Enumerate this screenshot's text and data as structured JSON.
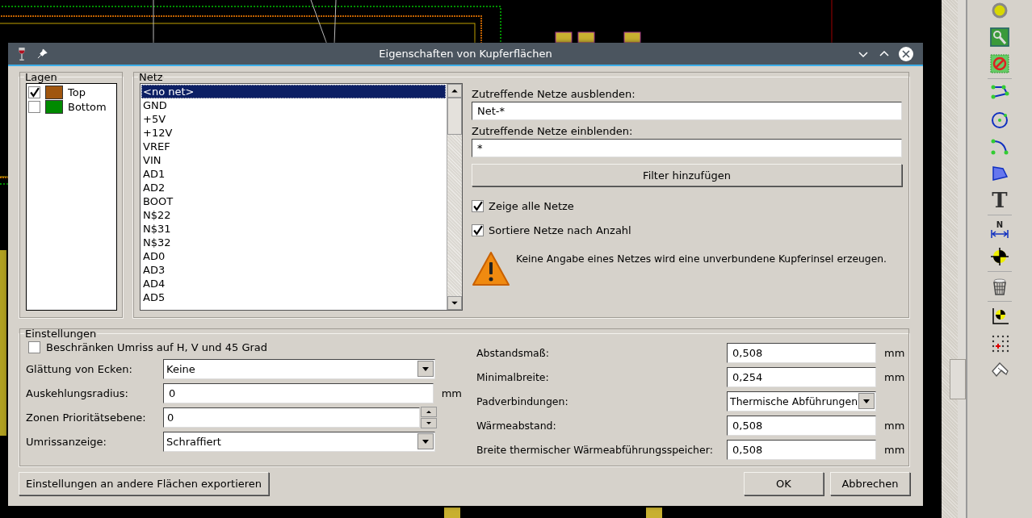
{
  "window": {
    "title": "Eigenschaften von Kupferflächen"
  },
  "layers": {
    "title": "Lagen",
    "items": [
      {
        "label": "Top",
        "checked": true,
        "color": "#a0560f"
      },
      {
        "label": "Bottom",
        "checked": false,
        "color": "#008a00"
      }
    ]
  },
  "net": {
    "title": "Netz",
    "items": [
      {
        "label": "<no net>",
        "selected": true
      },
      {
        "label": "GND",
        "selected": false
      },
      {
        "label": "+5V",
        "selected": false
      },
      {
        "label": "+12V",
        "selected": false
      },
      {
        "label": "VREF",
        "selected": false
      },
      {
        "label": "VIN",
        "selected": false
      },
      {
        "label": "AD1",
        "selected": false
      },
      {
        "label": "AD2",
        "selected": false
      },
      {
        "label": "BOOT",
        "selected": false
      },
      {
        "label": "N$22",
        "selected": false
      },
      {
        "label": "N$31",
        "selected": false
      },
      {
        "label": "N$32",
        "selected": false
      },
      {
        "label": "AD0",
        "selected": false
      },
      {
        "label": "AD3",
        "selected": false
      },
      {
        "label": "AD4",
        "selected": false
      },
      {
        "label": "AD5",
        "selected": false
      }
    ],
    "hide_filter": {
      "label": "Zutreffende Netze ausblenden:",
      "value": "Net-*"
    },
    "show_filter": {
      "label": "Zutreffende Netze einblenden:",
      "value": "*"
    },
    "add_filter_button": "Filter hinzufügen",
    "options": [
      {
        "label": "Zeige alle Netze",
        "checked": true
      },
      {
        "label": "Sortiere Netze nach Anzahl",
        "checked": true
      }
    ],
    "warning": "Keine Angabe eines Netzes wird eine unverbundene Kupferinsel erzeugen."
  },
  "settings": {
    "title": "Einstellungen",
    "left": [
      {
        "kind": "checkbox",
        "label": "Beschränken Umriss auf H, V und 45 Grad",
        "checked": false
      },
      {
        "kind": "select",
        "label": "Glättung von Ecken:",
        "value": "Keine"
      },
      {
        "kind": "input",
        "label": "Auskehlungsradius:",
        "value": "0",
        "unit": "mm"
      },
      {
        "kind": "spin",
        "label": "Zonen Prioritätsebene:",
        "value": "0"
      },
      {
        "kind": "select",
        "label": "Umrissanzeige:",
        "value": "Schraffiert"
      }
    ],
    "right": [
      {
        "kind": "input",
        "label": "Abstandsmaß:",
        "value": "0,508",
        "unit": "mm"
      },
      {
        "kind": "input",
        "label": "Minimalbreite:",
        "value": "0,254",
        "unit": "mm"
      },
      {
        "kind": "select",
        "label": "Padverbindungen:",
        "value": "Thermische Abführungen"
      },
      {
        "kind": "input",
        "label": "Wärmeabstand:",
        "value": "0,508",
        "unit": "mm"
      },
      {
        "kind": "input",
        "label": "Breite thermischer Wärmeabführungsspeicher:",
        "value": "0,508",
        "unit": "mm"
      }
    ]
  },
  "buttons": {
    "export": "Einstellungen an andere Flächen exportieren",
    "ok": "OK",
    "cancel": "Abbrechen"
  },
  "toolbar": {
    "text_glyph": "T",
    "dimension_glyph": "N"
  }
}
